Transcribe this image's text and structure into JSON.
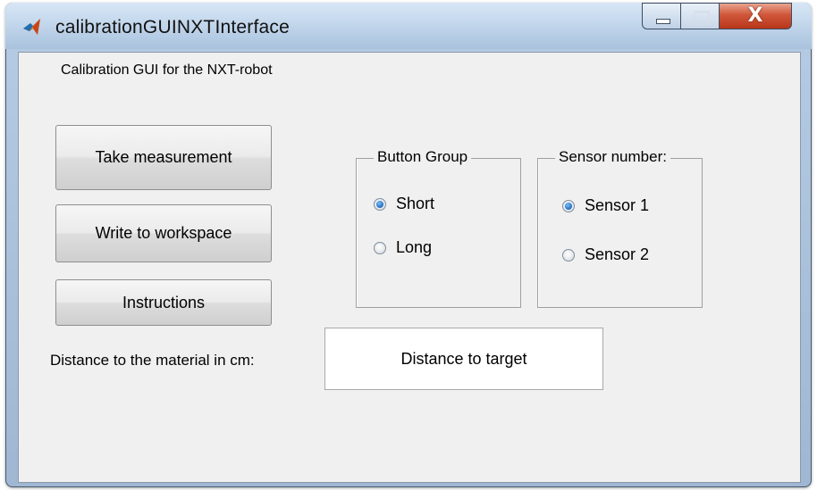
{
  "window": {
    "title": "calibrationGUINXTInterface",
    "controls": {
      "close_glyph": "X"
    },
    "icons": {
      "app": "matlab-logo-icon",
      "minimize": "minimize-icon",
      "maximize": "maximize-icon",
      "close": "close-icon"
    },
    "colors": {
      "titlebar": "#c3d7ec",
      "close_button": "#c84c2e",
      "client": "#f0f0f0"
    }
  },
  "gui": {
    "title": "Calibration GUI for the NXT-robot",
    "buttons": {
      "take_measurement": "Take measurement",
      "write_to_workspace": "Write to workspace",
      "instructions": "Instructions"
    },
    "distance_label": "Distance to the material in cm:",
    "distance_display": "Distance to target",
    "button_group": {
      "title": "Button Group",
      "options": [
        {
          "label": "Short",
          "selected": true
        },
        {
          "label": "Long",
          "selected": false
        }
      ]
    },
    "sensor_group": {
      "title": "Sensor number:",
      "options": [
        {
          "label": "Sensor 1",
          "selected": true
        },
        {
          "label": "Sensor 2",
          "selected": false
        }
      ]
    }
  }
}
